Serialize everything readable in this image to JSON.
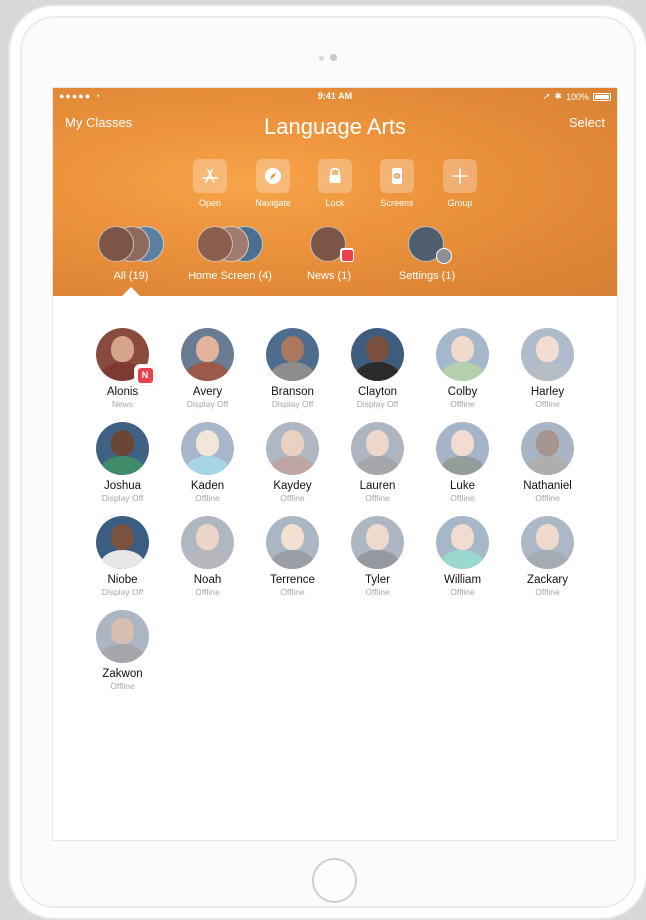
{
  "status_bar": {
    "carrier": "●●●●● ",
    "time": "9:41 AM",
    "battery_text": "100%"
  },
  "nav": {
    "left": "My Classes",
    "title": "Language Arts",
    "right": "Select"
  },
  "toolbar": [
    {
      "label": "Open",
      "icon": "app-store-icon"
    },
    {
      "label": "Navigate",
      "icon": "compass-icon"
    },
    {
      "label": "Lock",
      "icon": "lock-icon"
    },
    {
      "label": "Screens",
      "icon": "screens-icon"
    },
    {
      "label": "Group",
      "icon": "plus-icon"
    }
  ],
  "groups": [
    {
      "label": "All (19)",
      "selected": true
    },
    {
      "label": "Home Screen (4)"
    },
    {
      "label": "News (1)"
    },
    {
      "label": "Settings (1)"
    }
  ],
  "students": [
    {
      "name": "Alonis",
      "status": "News",
      "badge": "news"
    },
    {
      "name": "Avery",
      "status": "Display Off"
    },
    {
      "name": "Branson",
      "status": "Display Off"
    },
    {
      "name": "Clayton",
      "status": "Display Off"
    },
    {
      "name": "Colby",
      "status": "Offline"
    },
    {
      "name": "Harley",
      "status": "Offline"
    },
    {
      "name": "Joshua",
      "status": "Display Off"
    },
    {
      "name": "Kaden",
      "status": "Offline"
    },
    {
      "name": "Kaydey",
      "status": "Offline"
    },
    {
      "name": "Lauren",
      "status": "Offline"
    },
    {
      "name": "Luke",
      "status": "Offline"
    },
    {
      "name": "Nathaniel",
      "status": "Offline"
    },
    {
      "name": "Niobe",
      "status": "Display Off"
    },
    {
      "name": "Noah",
      "status": "Offline"
    },
    {
      "name": "Terrence",
      "status": "Offline"
    },
    {
      "name": "Tyler",
      "status": "Offline"
    },
    {
      "name": "William",
      "status": "Offline"
    },
    {
      "name": "Zackary",
      "status": "Offline"
    },
    {
      "name": "Zakwon",
      "status": "Offline"
    }
  ],
  "colors": {
    "header_accent": "#ed943d",
    "badge": "#e8414b",
    "status_text": "#a6a6a6"
  }
}
